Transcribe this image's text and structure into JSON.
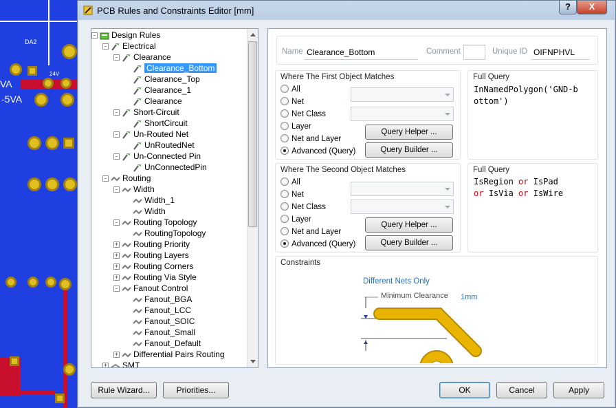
{
  "window": {
    "title": "PCB Rules and Constraints Editor [mm]",
    "help_label": "?",
    "close_label": "X"
  },
  "pcb": {
    "labels": [
      "DA2",
      "24V",
      "-5VA",
      "VA"
    ]
  },
  "tree": [
    {
      "label": "Design Rules",
      "level": 0,
      "icon": "design-rules-icon",
      "expander": "-"
    },
    {
      "label": "Electrical",
      "level": 1,
      "icon": "rule-category-icon",
      "expander": "-"
    },
    {
      "label": "Clearance",
      "level": 2,
      "icon": "rule-type-icon",
      "expander": "-"
    },
    {
      "label": "Clearance_Bottom",
      "level": 3,
      "icon": "rule-icon",
      "expander": "",
      "selected": true
    },
    {
      "label": "Clearance_Top",
      "level": 3,
      "icon": "rule-icon",
      "expander": ""
    },
    {
      "label": "Clearance_1",
      "level": 3,
      "icon": "rule-icon",
      "expander": ""
    },
    {
      "label": "Clearance",
      "level": 3,
      "icon": "rule-icon",
      "expander": ""
    },
    {
      "label": "Short-Circuit",
      "level": 2,
      "icon": "rule-type-icon",
      "expander": "-"
    },
    {
      "label": "ShortCircuit",
      "level": 3,
      "icon": "rule-icon",
      "expander": ""
    },
    {
      "label": "Un-Routed Net",
      "level": 2,
      "icon": "rule-type-icon",
      "expander": "-"
    },
    {
      "label": "UnRoutedNet",
      "level": 3,
      "icon": "rule-icon",
      "expander": ""
    },
    {
      "label": "Un-Connected Pin",
      "level": 2,
      "icon": "rule-type-icon",
      "expander": "-"
    },
    {
      "label": "UnConnectedPin",
      "level": 3,
      "icon": "rule-icon",
      "expander": ""
    },
    {
      "label": "Routing",
      "level": 1,
      "icon": "routing-category-icon",
      "expander": "-"
    },
    {
      "label": "Width",
      "level": 2,
      "icon": "routing-type-icon",
      "expander": "-"
    },
    {
      "label": "Width_1",
      "level": 3,
      "icon": "routing-rule-icon",
      "expander": ""
    },
    {
      "label": "Width",
      "level": 3,
      "icon": "routing-rule-icon",
      "expander": ""
    },
    {
      "label": "Routing Topology",
      "level": 2,
      "icon": "routing-type-icon",
      "expander": "-"
    },
    {
      "label": "RoutingTopology",
      "level": 3,
      "icon": "routing-rule-icon",
      "expander": ""
    },
    {
      "label": "Routing Priority",
      "level": 2,
      "icon": "routing-type-icon",
      "expander": "+"
    },
    {
      "label": "Routing Layers",
      "level": 2,
      "icon": "routing-type-icon",
      "expander": "+"
    },
    {
      "label": "Routing Corners",
      "level": 2,
      "icon": "routing-type-icon",
      "expander": "+"
    },
    {
      "label": "Routing Via Style",
      "level": 2,
      "icon": "routing-type-icon",
      "expander": "+"
    },
    {
      "label": "Fanout Control",
      "level": 2,
      "icon": "routing-type-icon",
      "expander": "-"
    },
    {
      "label": "Fanout_BGA",
      "level": 3,
      "icon": "routing-rule-icon",
      "expander": ""
    },
    {
      "label": "Fanout_LCC",
      "level": 3,
      "icon": "routing-rule-icon",
      "expander": ""
    },
    {
      "label": "Fanout_SOIC",
      "level": 3,
      "icon": "routing-rule-icon",
      "expander": ""
    },
    {
      "label": "Fanout_Small",
      "level": 3,
      "icon": "routing-rule-icon",
      "expander": ""
    },
    {
      "label": "Fanout_Default",
      "level": 3,
      "icon": "routing-rule-icon",
      "expander": ""
    },
    {
      "label": "Differential Pairs Routing",
      "level": 2,
      "icon": "routing-type-icon",
      "expander": "+"
    },
    {
      "label": "SMT",
      "level": 1,
      "icon": "smt-category-icon",
      "expander": "+"
    }
  ],
  "header": {
    "name_label": "Name",
    "name_value": "Clearance_Bottom",
    "comment_label": "Comment",
    "comment_value": "",
    "uid_label": "Unique ID",
    "uid_value": "OIFNPHVL"
  },
  "first_match": {
    "title": "Where The First Object Matches",
    "options": [
      "All",
      "Net",
      "Net Class",
      "Layer",
      "Net and Layer",
      "Advanced (Query)"
    ],
    "selected": "Advanced (Query)",
    "helper_label": "Query Helper ...",
    "builder_label": "Query Builder ...",
    "full_query_label": "Full Query",
    "query_lines": [
      "InNamedPolygon('GND-b",
      "ottom')"
    ]
  },
  "second_match": {
    "title": "Where The Second Object Matches",
    "options": [
      "All",
      "Net",
      "Net Class",
      "Layer",
      "Net and Layer",
      "Advanced (Query)"
    ],
    "selected": "Advanced (Query)",
    "helper_label": "Query Helper ...",
    "builder_label": "Query Builder ...",
    "full_query_label": "Full Query",
    "query_tokens": {
      "l1a": "IsRegion",
      "l1b": "or",
      "l1c": "IsPad",
      "l2a": "or",
      "l2b": "IsVia",
      "l2c": "or",
      "l2d": "IsWire"
    }
  },
  "constraints": {
    "title": "Constraints",
    "caption": "Different Nets Only",
    "min_label": "Minimum Clearance",
    "min_value": "1mm"
  },
  "footer": {
    "rule_wizard": "Rule Wizard...",
    "priorities": "Priorities...",
    "ok": "OK",
    "cancel": "Cancel",
    "apply": "Apply"
  },
  "colors": {
    "selection": "#3399ff",
    "keyword": "#d4000f",
    "caption_blue": "#1f6fc5",
    "track": "#e8b400"
  }
}
